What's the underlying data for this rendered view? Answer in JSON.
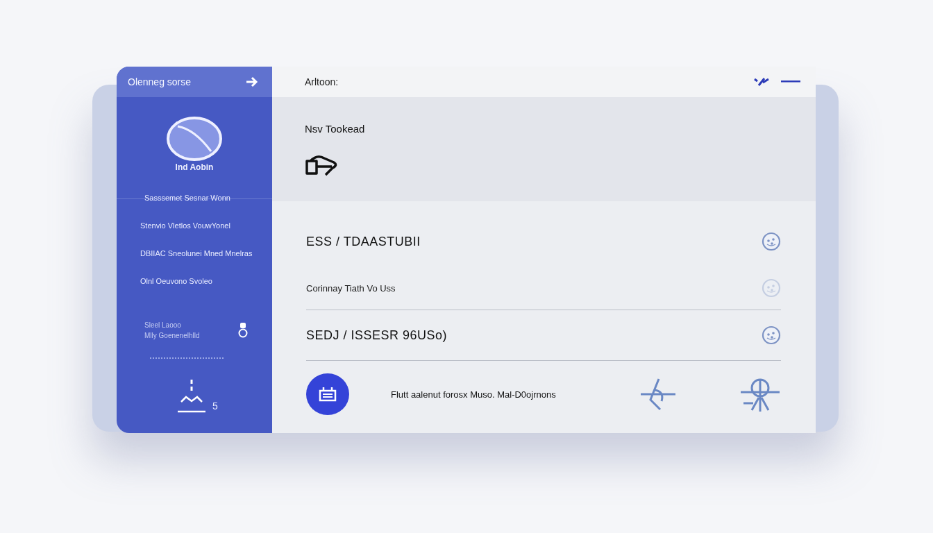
{
  "sidebar": {
    "title": "Olenneg sorse",
    "profile": {
      "name": "Ind Aobin"
    },
    "items": [
      {
        "label": "Sasssemet Sesnar Wonn"
      },
      {
        "label": "Stenvio Vletlos VouwYonel"
      },
      {
        "label": "DBIIAC Sneolunei Mned Mnelras"
      },
      {
        "label": "Olnl Oeuvono Svoleo"
      }
    ],
    "note": {
      "lines": [
        "Sleel Laooo",
        "Mlly Goenenelhlld"
      ]
    },
    "footer": {
      "count": "5"
    }
  },
  "main": {
    "header": {
      "title": "Arltoon:"
    },
    "hero": {
      "title": "Nsv Tookead"
    },
    "rows": [
      {
        "title": "ESS / TDAASTUBII",
        "kind": "heading",
        "divider": false
      },
      {
        "title": "Corinnay Tiath Vo Uss",
        "kind": "sub",
        "divider": true
      },
      {
        "title": "SEDJ / ISSESR 96USo)",
        "kind": "heading",
        "divider": true
      }
    ],
    "action": {
      "text": "Flutt aalenut forosx Muso. Mal-D0ojrnons"
    }
  }
}
